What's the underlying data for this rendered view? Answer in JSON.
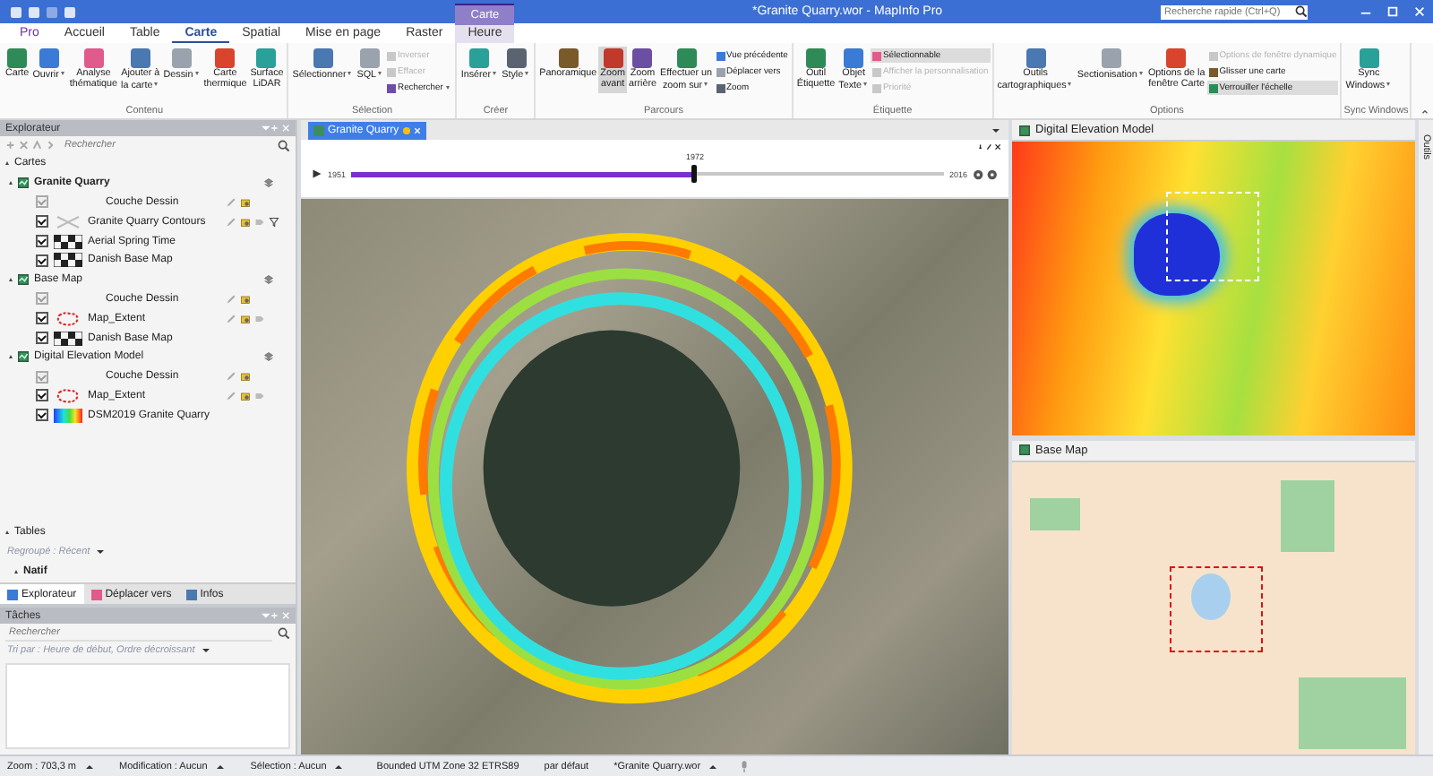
{
  "window": {
    "title": "*Granite Quarry.wor - MapInfo Pro",
    "search_placeholder": "Recherche rapide (Ctrl+Q)"
  },
  "ribbon_tabs": [
    {
      "label": "Pro",
      "selected": false,
      "kind": "file"
    },
    {
      "label": "Accueil",
      "selected": false,
      "kind": "normal"
    },
    {
      "label": "Table",
      "selected": false,
      "kind": "normal"
    },
    {
      "label": "Carte",
      "selected": true,
      "kind": "normal"
    },
    {
      "label": "Spatial",
      "selected": false,
      "kind": "normal"
    },
    {
      "label": "Mise en page",
      "selected": false,
      "kind": "normal"
    },
    {
      "label": "Raster",
      "selected": false,
      "kind": "normal"
    },
    {
      "label": "Heure",
      "selected": false,
      "kind": "context",
      "context_label": "Carte"
    }
  ],
  "ribbon_groups": [
    {
      "label": "Contenu",
      "items": [
        {
          "kind": "large",
          "label": "Carte",
          "dropdown": false,
          "selected": false
        },
        {
          "kind": "large",
          "label": "Ouvrir",
          "dropdown": true,
          "selected": false
        },
        {
          "kind": "large",
          "label": "Analyse\nthématique",
          "dropdown": false,
          "selected": false
        },
        {
          "kind": "large",
          "label": "Ajouter à\nla carte",
          "dropdown": true,
          "selected": false
        },
        {
          "kind": "large",
          "label": "Dessin",
          "dropdown": true,
          "selected": false
        },
        {
          "kind": "large",
          "label": "Carte\nthermique",
          "dropdown": false,
          "selected": false
        },
        {
          "kind": "large",
          "label": "Surface\nLiDAR",
          "dropdown": false,
          "selected": false
        }
      ]
    },
    {
      "label": "Sélection",
      "items": [
        {
          "kind": "large",
          "label": "Sélectionner",
          "dropdown": true,
          "selected": false
        },
        {
          "kind": "large",
          "label": "SQL",
          "dropdown": true,
          "selected": false
        },
        {
          "kind": "stack",
          "items": [
            {
              "label": "Inverser",
              "disabled": true,
              "selected": false,
              "dropdown": false
            },
            {
              "label": "Effacer",
              "disabled": true,
              "selected": false,
              "dropdown": false
            },
            {
              "label": "Rechercher",
              "disabled": false,
              "selected": false,
              "dropdown": true
            }
          ]
        }
      ]
    },
    {
      "label": "Créer",
      "items": [
        {
          "kind": "large",
          "label": "Insérer",
          "dropdown": true,
          "selected": false
        },
        {
          "kind": "large",
          "label": "Style",
          "dropdown": true,
          "selected": false
        }
      ]
    },
    {
      "label": "Parcours",
      "items": [
        {
          "kind": "large",
          "label": "Panoramique",
          "dropdown": false,
          "selected": false
        },
        {
          "kind": "large",
          "label": "Zoom\navant",
          "dropdown": false,
          "selected": true
        },
        {
          "kind": "large",
          "label": "Zoom\narrière",
          "dropdown": false,
          "selected": false
        },
        {
          "kind": "large",
          "label": "Effectuer un\nzoom sur",
          "dropdown": true,
          "selected": false
        },
        {
          "kind": "stack",
          "items": [
            {
              "label": "Vue précédente",
              "disabled": false,
              "selected": false,
              "dropdown": false
            },
            {
              "label": "Déplacer vers",
              "disabled": false,
              "selected": false,
              "dropdown": false
            },
            {
              "label": "Zoom",
              "disabled": false,
              "selected": false,
              "dropdown": false
            }
          ]
        }
      ]
    },
    {
      "label": "Étiquette",
      "items": [
        {
          "kind": "large",
          "label": "Outil\nÉtiquette",
          "dropdown": false,
          "selected": false
        },
        {
          "kind": "large",
          "label": "Objet\nTexte",
          "dropdown": true,
          "selected": false
        },
        {
          "kind": "stack",
          "items": [
            {
              "label": "Sélectionnable",
              "disabled": false,
              "selected": true,
              "dropdown": false
            },
            {
              "label": "Afficher la personnalisation",
              "disabled": true,
              "selected": false,
              "dropdown": false
            },
            {
              "label": "Priorité",
              "disabled": true,
              "selected": false,
              "dropdown": false
            }
          ]
        }
      ]
    },
    {
      "label": "Options",
      "items": [
        {
          "kind": "large",
          "label": "Outils\ncartographiques",
          "dropdown": true,
          "selected": false
        },
        {
          "kind": "large",
          "label": "Sectionisation",
          "dropdown": true,
          "selected": false
        },
        {
          "kind": "large",
          "label": "Options de la\nfenêtre Carte",
          "dropdown": false,
          "selected": false
        },
        {
          "kind": "stack",
          "items": [
            {
              "label": "Options de fenêtre dynamique",
              "disabled": true,
              "selected": false,
              "dropdown": false
            },
            {
              "label": "Glisser une carte",
              "disabled": false,
              "selected": false,
              "dropdown": false
            },
            {
              "label": "Verrouiller l'échelle",
              "disabled": false,
              "selected": true,
              "dropdown": false
            }
          ]
        }
      ]
    },
    {
      "label": "Sync Windows",
      "items": [
        {
          "kind": "large",
          "label": "Sync\nWindows",
          "dropdown": true,
          "selected": false
        }
      ]
    }
  ],
  "explorer": {
    "title": "Explorateur",
    "search_placeholder": "Rechercher",
    "maps_section": {
      "label": "Cartes",
      "expanded": true,
      "children": [
        {
          "label": "Granite Quarry",
          "bold": true,
          "expanded": true,
          "children": [
            {
              "label": "Couche Dessin",
              "checked": true,
              "disabled": true,
              "kind": "cosmetic"
            },
            {
              "label": "Granite Quarry Contours",
              "checked": true,
              "disabled": false,
              "kind": "contours"
            },
            {
              "label": "Aerial Spring Time",
              "checked": true,
              "disabled": false,
              "kind": "raster"
            },
            {
              "label": "Danish Base Map",
              "checked": true,
              "disabled": false,
              "kind": "raster"
            }
          ]
        },
        {
          "label": "Base Map",
          "bold": false,
          "expanded": true,
          "children": [
            {
              "label": "Couche Dessin",
              "checked": true,
              "disabled": true,
              "kind": "cosmetic"
            },
            {
              "label": "Map_Extent",
              "checked": true,
              "disabled": false,
              "kind": "region"
            },
            {
              "label": "Danish Base Map",
              "checked": true,
              "disabled": false,
              "kind": "raster"
            }
          ]
        },
        {
          "label": "Digital Elevation Model",
          "bold": false,
          "expanded": true,
          "children": [
            {
              "label": "Couche Dessin",
              "checked": true,
              "disabled": true,
              "kind": "cosmetic"
            },
            {
              "label": "Map_Extent",
              "checked": true,
              "disabled": false,
              "kind": "region"
            },
            {
              "label": "DSM2019 Granite Quarry",
              "checked": true,
              "disabled": false,
              "kind": "grid"
            }
          ]
        }
      ]
    },
    "tables_section": {
      "label": "Tables",
      "expanded": true,
      "group_by": "Regroupé : Récent",
      "children": [
        {
          "label": "Natif",
          "expanded": true
        }
      ]
    },
    "tabs": [
      {
        "label": "Explorateur",
        "selected": true
      },
      {
        "label": "Déplacer vers",
        "selected": false
      },
      {
        "label": "Infos",
        "selected": false
      }
    ]
  },
  "tasks": {
    "title": "Tâches",
    "search_placeholder": "Rechercher",
    "sort": "Tri par : Heure de début, Ordre décroissant"
  },
  "map_tabs": [
    {
      "label": "Granite Quarry",
      "selected": true,
      "modified": true
    }
  ],
  "timeline": {
    "start": "1951",
    "current": "1972",
    "end": "2016",
    "level": 0.58
  },
  "side_windows": [
    {
      "title": "Digital Elevation Model",
      "kind": "dem"
    },
    {
      "title": "Base Map",
      "kind": "base"
    }
  ],
  "side_strip": {
    "label": "Outils"
  },
  "status_bar": {
    "left": [
      "Zoom : 703,3 m",
      "Modification : Aucun",
      "Sélection : Aucun"
    ],
    "projection": "Bounded UTM Zone 32 ETRS89",
    "style": "par défaut",
    "workspace": "*Granite Quarry.wor"
  }
}
